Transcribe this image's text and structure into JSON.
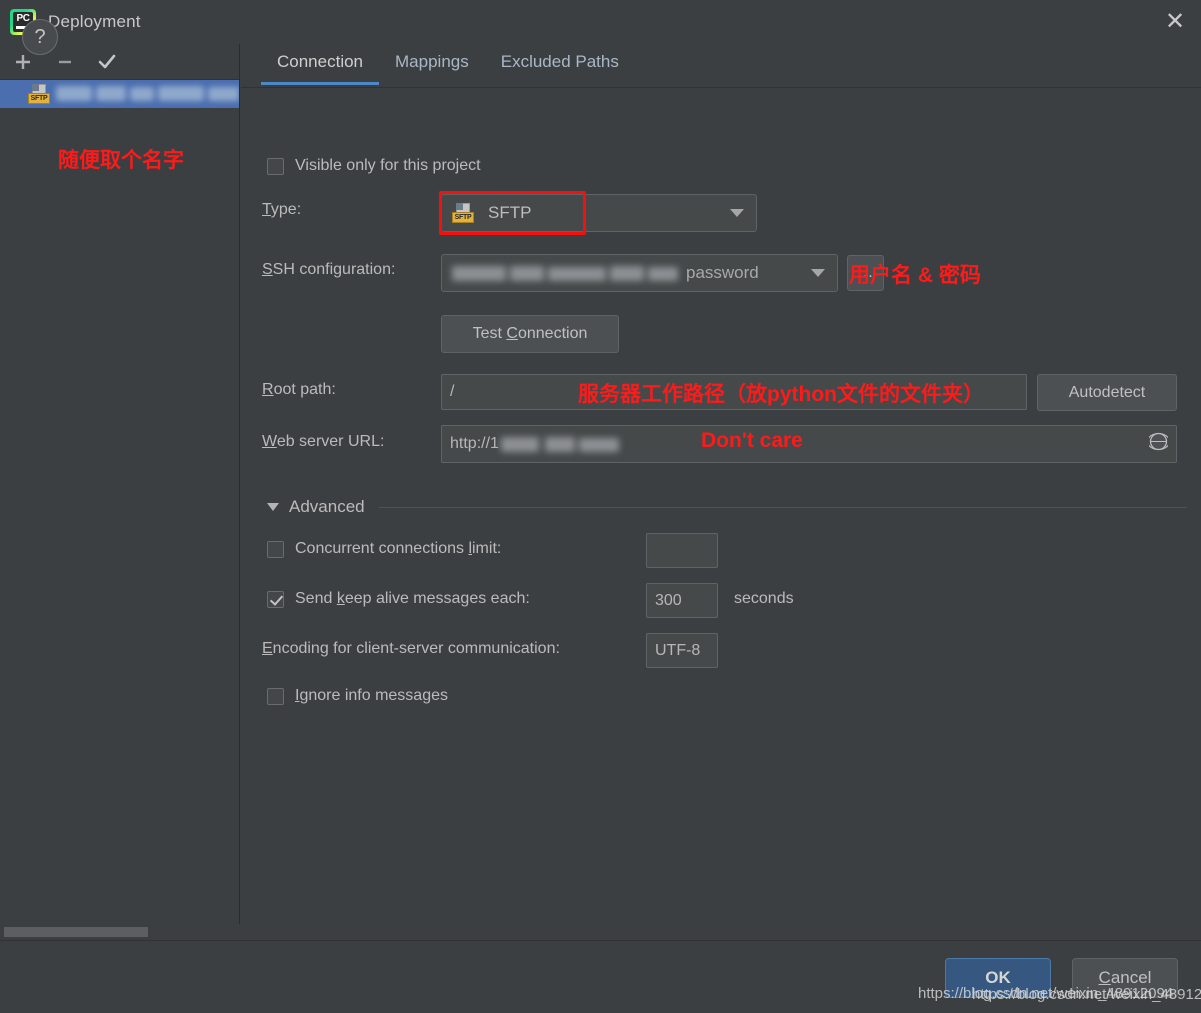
{
  "window": {
    "title": "Deployment",
    "logo_icon": "pycharm-logo-icon",
    "logo_text": "PC",
    "close_icon": "close-icon"
  },
  "sidebar": {
    "toolbar": [
      {
        "name": "add-server-button",
        "icon": "plus-icon",
        "label": "+"
      },
      {
        "name": "remove-server-button",
        "icon": "minus-icon",
        "label": "−"
      },
      {
        "name": "set-default-button",
        "icon": "check-icon",
        "label": "✓"
      }
    ],
    "server": {
      "icon": "sftp-file-icon",
      "icon_badge": "SFTP",
      "name_redacted": true,
      "name": ""
    },
    "annotation": "随便取个名字",
    "scrollbar": "horizontal-scrollbar"
  },
  "main": {
    "tabs": [
      {
        "label": "Connection",
        "active": true
      },
      {
        "label": "Mappings",
        "active": false
      },
      {
        "label": "Excluded Paths",
        "active": false
      }
    ],
    "visible_only": {
      "label": "Visible only for this project",
      "checked": false
    },
    "type": {
      "label": "Type:",
      "label_mnemonic": "T",
      "value": "SFTP",
      "icon": "sftp-file-icon",
      "icon_badge": "SFTP",
      "highlighted": true,
      "highlight_color": "#f51010",
      "dropdown_icon": "chevron-down-icon"
    },
    "ssh_configuration": {
      "label": "SSH configuration:",
      "label_mnemonic": "S",
      "value_redacted": true,
      "value_suffix": "password",
      "dropdown_icon": "chevron-down-icon",
      "browse_label": "...",
      "annotation": "用户名 & 密码"
    },
    "test_connection": {
      "label": "Test Connection",
      "mnemonic": "C"
    },
    "root_path": {
      "label": "Root path:",
      "label_mnemonic": "R",
      "value": "/",
      "annotation": "服务器工作路径（放python文件的文件夹）",
      "autodetect_label": "Autodetect"
    },
    "web_server_url": {
      "label": "Web server URL:",
      "label_mnemonic": "W",
      "value": "http://1",
      "value_redacted": true,
      "annotation": "Don't care",
      "globe_icon": "globe-icon"
    },
    "advanced": {
      "label": "Advanced",
      "expanded": true,
      "caret_icon": "chevron-down-icon",
      "concurrent_limit": {
        "label": "Concurrent connections limit:",
        "label_mnemonic": "l",
        "checked": false,
        "value": ""
      },
      "keep_alive": {
        "label": "Send keep alive messages each:",
        "label_mnemonic": "k",
        "checked": true,
        "value": "300",
        "unit": "seconds"
      },
      "encoding": {
        "label": "Encoding for client-server communication:",
        "label_mnemonic": "E",
        "value": "UTF-8"
      },
      "ignore_info": {
        "label": "Ignore info messages",
        "label_mnemonic": "I",
        "checked": false
      }
    }
  },
  "footer": {
    "help_label": "?",
    "ok_label": "OK",
    "cancel_label": "Cancel",
    "cancel_mnemonic": "C",
    "watermark_a": "https://blog.csdn.net/weixin_48912094",
    "watermark_b": "https://blog.csdn.net/weixin_48912094"
  },
  "colors": {
    "background": "#3c3f41",
    "selection": "#4b6eaf",
    "accent": "#4a88c7",
    "annotation_red": "#ff1a1a",
    "ok_button": "#365880"
  }
}
